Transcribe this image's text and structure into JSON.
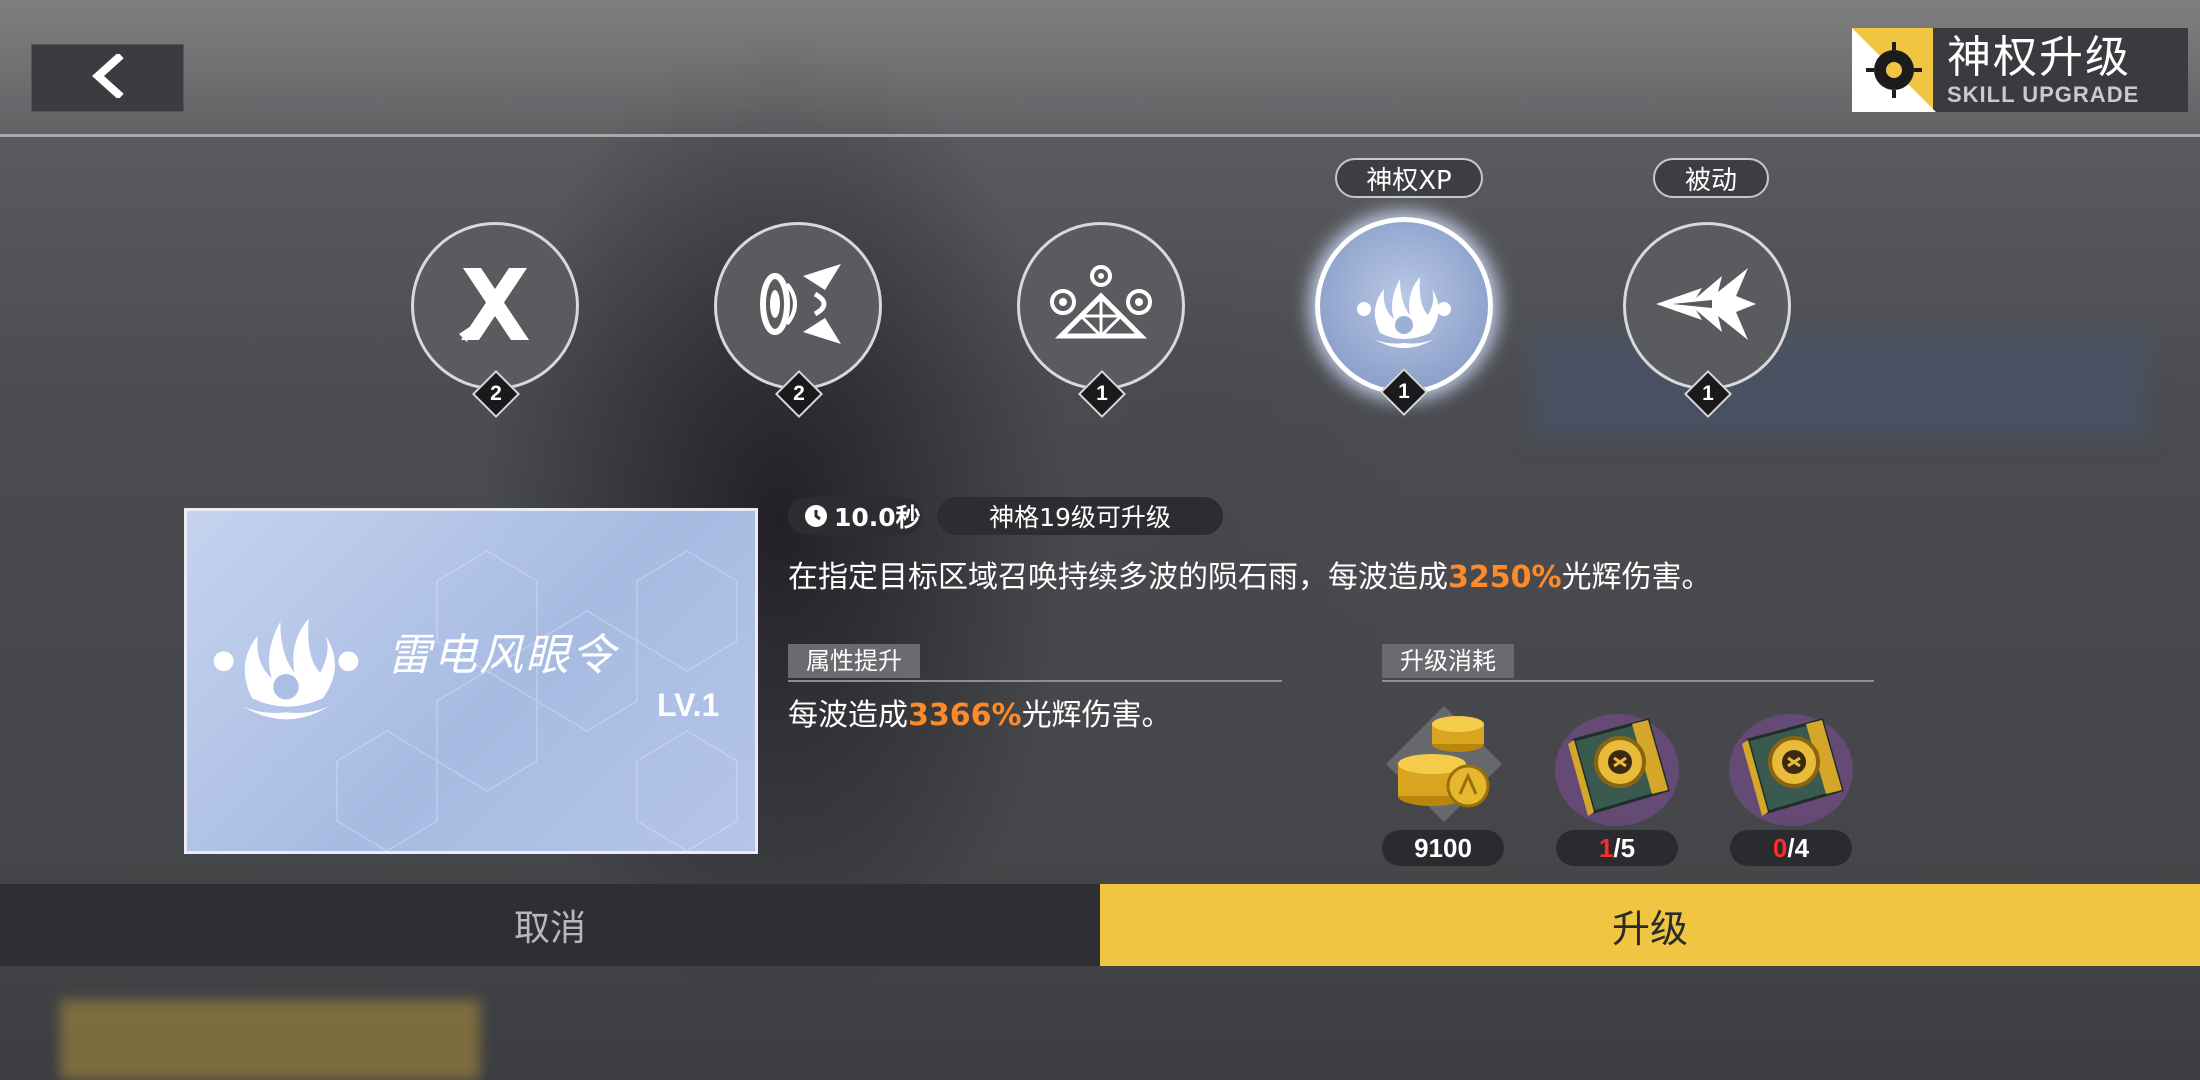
{
  "header": {
    "title": "神权升级",
    "subtitle": "SKILL UPGRADE"
  },
  "skills": [
    {
      "icon": "cross-blades-icon",
      "level": "2"
    },
    {
      "icon": "vortex-icon",
      "level": "2"
    },
    {
      "icon": "crystal-summon-icon",
      "level": "1"
    },
    {
      "icon": "meteor-flame-icon",
      "level": "1",
      "tag": "神权XP",
      "selected": true
    },
    {
      "icon": "burst-arrow-icon",
      "level": "1",
      "tag": "被动"
    }
  ],
  "card": {
    "name": "雷电风眼令",
    "level": "LV.1"
  },
  "info": {
    "cooldown": "10.0秒",
    "requirement": "神格19级可升级",
    "description_pre": "在指定目标区域召唤持续多波的陨石雨，每波造成",
    "description_value": "3250%",
    "description_post": "光辉伤害。"
  },
  "attribute": {
    "heading": "属性提升",
    "text_pre": "每波造成",
    "text_value": "3366%",
    "text_post": "光辉伤害。"
  },
  "cost": {
    "heading": "升级消耗",
    "items": [
      {
        "icon": "gold-coins-icon",
        "amount": "9100"
      },
      {
        "icon": "skill-book-icon",
        "have": "1",
        "need": "/5"
      },
      {
        "icon": "skill-book-icon",
        "have": "0",
        "need": "/4"
      }
    ]
  },
  "buttons": {
    "cancel": "取消",
    "upgrade": "升级"
  },
  "colors": {
    "accent": "#f0c541",
    "highlight": "#ff8a2a",
    "insufficient": "#ff2b2b"
  }
}
